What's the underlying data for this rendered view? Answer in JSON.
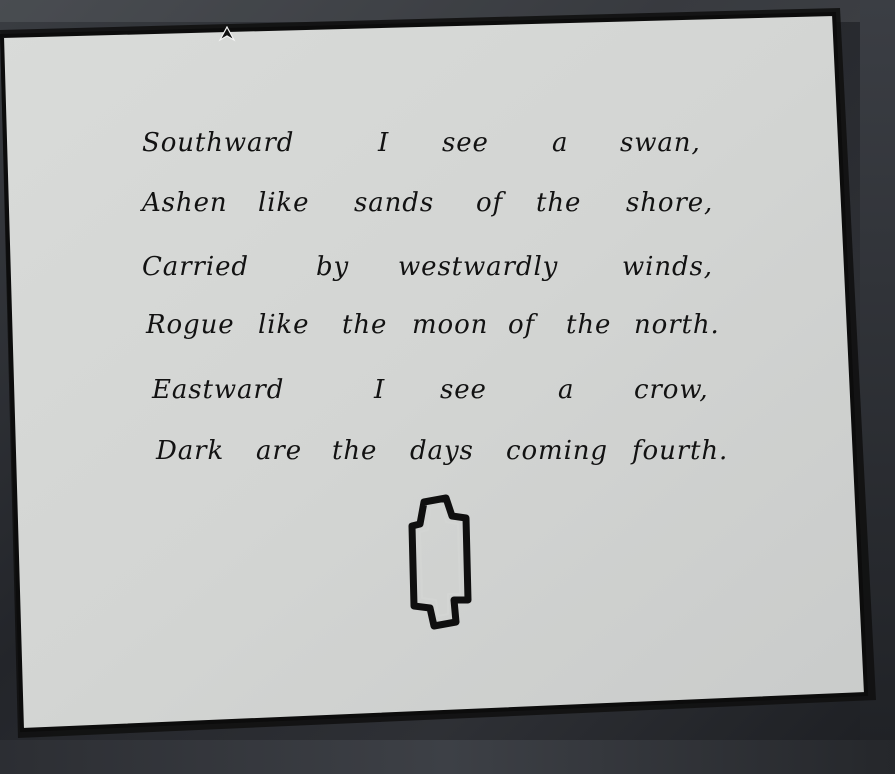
{
  "note": {
    "lines": [
      [
        "Southward",
        "I",
        "see",
        "a",
        "swan,"
      ],
      [
        "Ashen",
        "like",
        "sands",
        "of",
        "the",
        "shore,"
      ],
      [
        "Carried",
        "by",
        "westwardly",
        "winds,"
      ],
      [
        "Rogue",
        "like",
        "the",
        "moon",
        "of",
        "the",
        "north."
      ],
      [
        "Eastward",
        "I",
        "see",
        "a",
        "crow,"
      ],
      [
        "Dark",
        "are",
        "the",
        "days",
        "coming",
        "fourth."
      ]
    ],
    "glyph_icon": "rune-symbol-icon"
  },
  "cursor": {
    "icon": "pointer-cursor-icon"
  },
  "colors": {
    "paper": "#d6d8d6",
    "ink": "#121212",
    "background": "#2a2c30"
  }
}
